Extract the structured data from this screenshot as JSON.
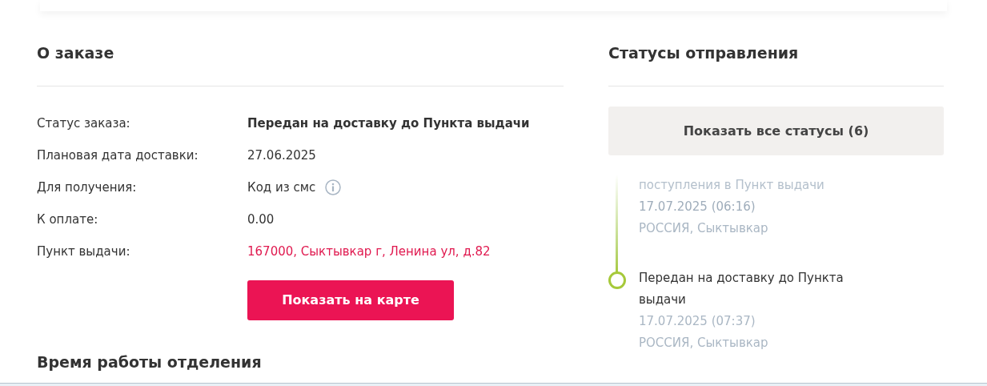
{
  "order": {
    "title": "О заказе",
    "fields": [
      {
        "label": "Статус заказа:",
        "value": "Передан на доставку до Пункта выдачи",
        "kind": "bold"
      },
      {
        "label": "Плановая дата доставки:",
        "value": "27.06.2025",
        "kind": "plain"
      },
      {
        "label": "Для получения:",
        "value": "Код из смс",
        "kind": "info"
      },
      {
        "label": "К оплате:",
        "value": "0.00",
        "kind": "plain"
      },
      {
        "label": "Пункт выдачи:",
        "value": "167000, Сыктывкар г, Ленина ул, д.82",
        "kind": "link"
      }
    ],
    "map_button": "Показать на карте",
    "hours_title": "Время работы отделения"
  },
  "statuses": {
    "title": "Статусы отправления",
    "show_all_button": "Показать все статусы (6)",
    "items": [
      {
        "title": "поступления в Пункт выдачи",
        "date": "17.07.2025 (06:16)",
        "place": "РОССИЯ, Сыктывкар",
        "faded": true
      },
      {
        "title": "Передан на доставку до Пункта выдачи",
        "date": "17.07.2025 (07:37)",
        "place": "РОССИЯ, Сыктывкар",
        "faded": false
      }
    ]
  }
}
